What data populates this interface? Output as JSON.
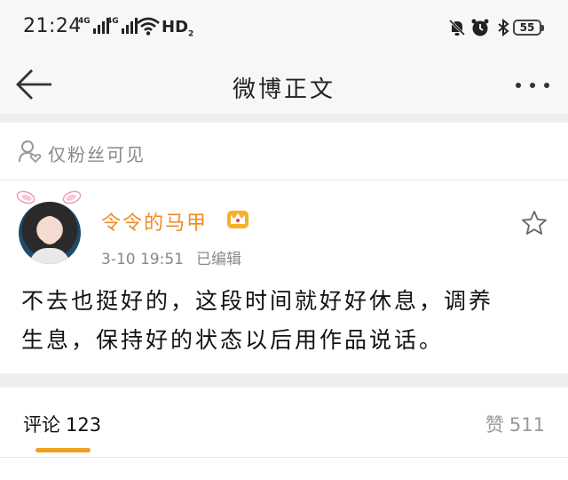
{
  "status_bar": {
    "time": "21:24",
    "signal1_label": "4G",
    "signal2_label": "4G",
    "network_label": "HD",
    "network_sub": "2",
    "battery": "55",
    "icons": [
      "mute-bell-icon",
      "alarm-icon",
      "bluetooth-icon"
    ]
  },
  "nav": {
    "title": "微博正文",
    "back_icon": "arrow-left-icon",
    "more_icon": "more-dots-icon"
  },
  "visibility": {
    "icon": "fans-only-icon",
    "text": "仅粉丝可见"
  },
  "post": {
    "username": "令令的马甲",
    "username_color": "#f08a24",
    "badge_icon": "crown-badge-icon",
    "date": "3-10 19:51",
    "edited": "已编辑",
    "content_line1": "不去也挺好的，这段时间就好好休息，调养",
    "content_line2": "生息，保持好的状态以后用作品说话。",
    "favorite_icon": "star-icon"
  },
  "tabs": {
    "comments_label": "评论",
    "comments_count": "123",
    "likes_label": "赞",
    "likes_count": "511",
    "accent": "#f0a020"
  }
}
